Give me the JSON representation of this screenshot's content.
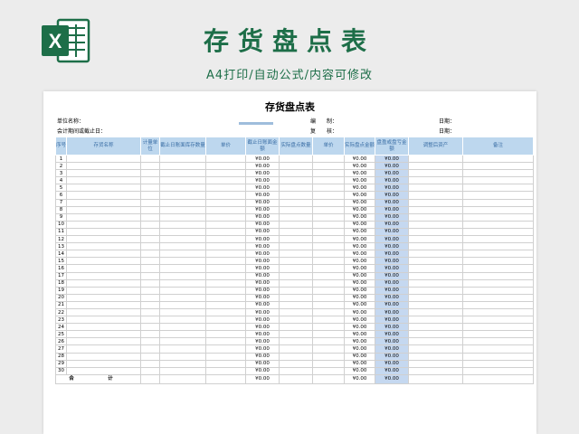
{
  "banner": {
    "title": "存货盘点表",
    "subtitle": "A4打印/自动公式/内容可修改",
    "logo_icon": "excel-logo-icon",
    "logo_letter": "X",
    "brand_color": "#1d6e48"
  },
  "sheet": {
    "title": "存货盘点表",
    "unit_name_label": "单位名称：",
    "period_label": "会计期间或截止日：",
    "prepared_label": "编　　制：",
    "reviewed_label": "复　　核：",
    "date_label_1": "日期：",
    "date_label_2": "日期：",
    "headers": [
      "序号",
      "存货名称",
      "计量单位",
      "截止日账面库存数量",
      "单价",
      "截止日账面金额",
      "实际盘点数量",
      "单价",
      "实际盘点金额",
      "盘盈或盘亏金额",
      "调整后资产",
      "备注"
    ],
    "row_count": 30,
    "row_numbers": [
      "1",
      "2",
      "3",
      "4",
      "5",
      "6",
      "7",
      "8",
      "9",
      "10",
      "11",
      "12",
      "13",
      "14",
      "15",
      "16",
      "17",
      "18",
      "19",
      "20",
      "21",
      "22",
      "23",
      "24",
      "25",
      "26",
      "27",
      "28",
      "29",
      "30"
    ],
    "zero_value": "¥0.00",
    "total_label": "合　计",
    "header_bg": "#bdd7ee",
    "highlight_col_bg": "#c5d8f0"
  }
}
